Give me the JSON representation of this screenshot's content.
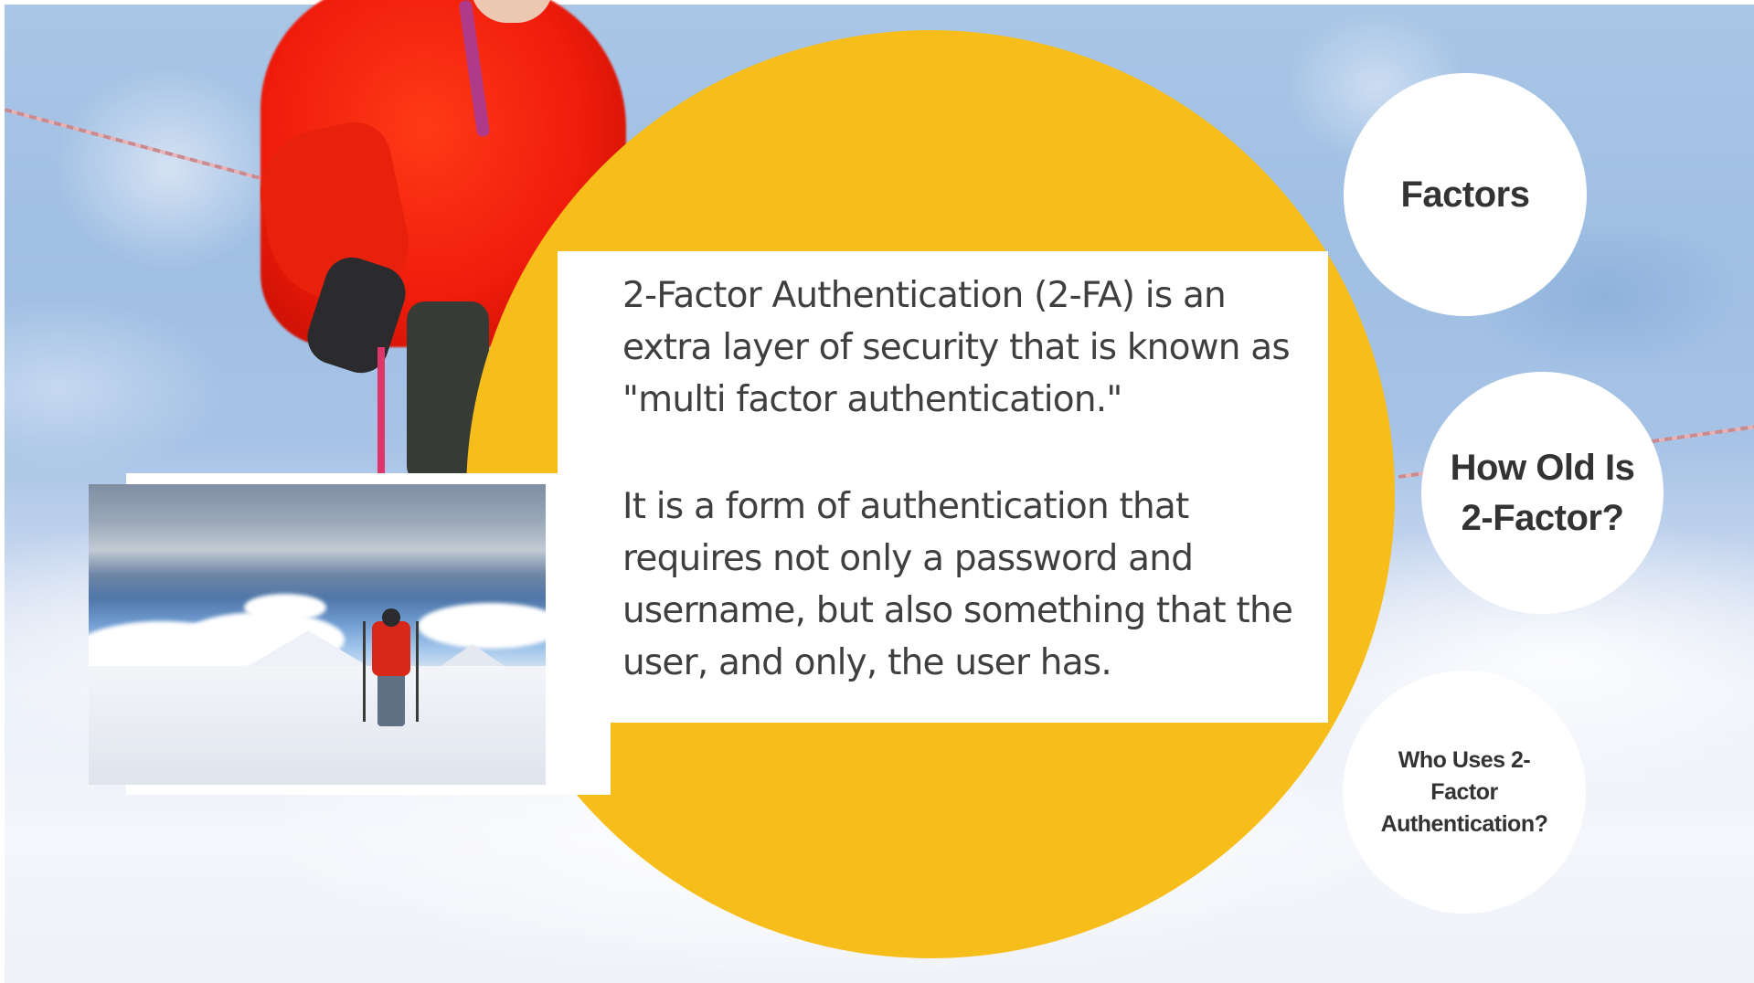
{
  "slide": {
    "body": {
      "paragraph_1": "2-Factor Authentication (2-FA) is an extra layer of security that is known as \"multi factor authentication.\"",
      "paragraph_2": "It is a form of authentication that requires not only a password and username, but also something that the user, and only, the user has."
    },
    "navigation": {
      "factors_label": "Factors",
      "how_old_label": "How Old Is 2-Factor?",
      "who_uses_label": "Who Uses 2-Factor Authentication?"
    },
    "colors": {
      "accent_circle": "#f7bd1a",
      "panel": "#ffffff",
      "text": "#3f3f3f",
      "nav_text": "#333333"
    },
    "images": {
      "background": "blurred-climber-on-ice-photo",
      "inset_photo": "hiker-on-snowy-mountain-photo"
    }
  }
}
